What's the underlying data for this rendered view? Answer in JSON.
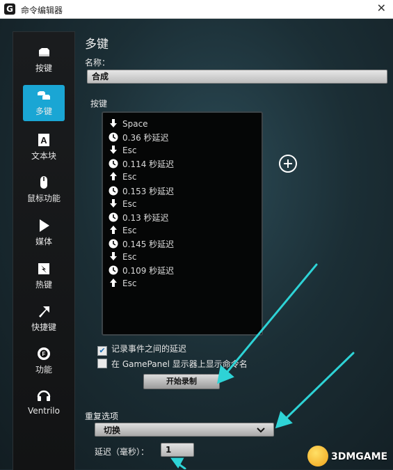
{
  "window": {
    "logo": "G",
    "title": "命令编辑器",
    "close_glyph": "✕"
  },
  "sidebar": {
    "items": [
      {
        "label": "按键",
        "icon": "key-icon",
        "active": false
      },
      {
        "label": "多键",
        "icon": "multikey-icon",
        "active": true
      },
      {
        "label": "文本块",
        "icon": "text-block-icon",
        "active": false
      },
      {
        "label": "鼠标功能",
        "icon": "mouse-icon",
        "active": false
      },
      {
        "label": "媒体",
        "icon": "play-icon",
        "active": false
      },
      {
        "label": "热键",
        "icon": "hotkey-icon",
        "active": false
      },
      {
        "label": "快捷键",
        "icon": "shortcut-arrow-icon",
        "active": false
      },
      {
        "label": "功能",
        "icon": "function-icon",
        "active": false
      },
      {
        "label": "Ventrilo",
        "icon": "headset-icon",
        "active": false
      }
    ]
  },
  "main": {
    "title": "多键",
    "name_label": "名称：",
    "name_value": "合成",
    "keys_label": "按键",
    "keystrokes": [
      {
        "type": "down",
        "text": "Space"
      },
      {
        "type": "delay",
        "text": "0.36 秒延迟"
      },
      {
        "type": "down",
        "text": "Esc"
      },
      {
        "type": "delay",
        "text": "0.114 秒延迟"
      },
      {
        "type": "up",
        "text": "Esc"
      },
      {
        "type": "delay",
        "text": "0.153 秒延迟"
      },
      {
        "type": "down",
        "text": "Esc"
      },
      {
        "type": "delay",
        "text": "0.13 秒延迟"
      },
      {
        "type": "up",
        "text": "Esc"
      },
      {
        "type": "delay",
        "text": "0.145 秒延迟"
      },
      {
        "type": "down",
        "text": "Esc"
      },
      {
        "type": "delay",
        "text": "0.109 秒延迟"
      },
      {
        "type": "up",
        "text": "Esc"
      }
    ],
    "options": {
      "record_delays_label": "记录事件之间的延迟",
      "record_delays_checked": true,
      "show_name_label": "在 GamePanel 显示器上显示命令名",
      "show_name_checked": false
    },
    "record_button": "开始录制",
    "repeat": {
      "title": "重复选项",
      "selected": "切换",
      "delay_label": "延迟（毫秒）：",
      "delay_value": "1"
    }
  },
  "watermark": {
    "text": "3DMGAME"
  },
  "colors": {
    "accent": "#1aa6d4",
    "annotation_arrow": "#2ed3d6"
  }
}
